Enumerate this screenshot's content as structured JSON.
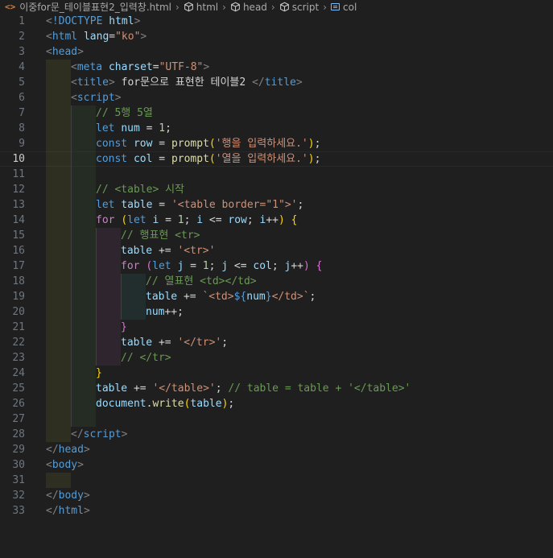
{
  "breadcrumb": {
    "file_name": "이중for문_테이블표현2_입력창.html",
    "items": [
      "html",
      "head",
      "script",
      "col"
    ]
  },
  "editor": {
    "current_line": 10,
    "lines": [
      {
        "n": 1,
        "indent": 0,
        "segs": [
          [
            "tag-punc",
            "<"
          ],
          [
            "tag",
            "!DOCTYPE"
          ],
          [
            "txt",
            " "
          ],
          [
            "attr",
            "html"
          ],
          [
            "tag-punc",
            ">"
          ]
        ]
      },
      {
        "n": 2,
        "indent": 0,
        "segs": [
          [
            "tag-punc",
            "<"
          ],
          [
            "tag",
            "html"
          ],
          [
            "txt",
            " "
          ],
          [
            "attr",
            "lang"
          ],
          [
            "txt",
            "="
          ],
          [
            "str",
            "\"ko\""
          ],
          [
            "tag-punc",
            ">"
          ]
        ]
      },
      {
        "n": 3,
        "indent": 0,
        "segs": [
          [
            "tag-punc",
            "<"
          ],
          [
            "tag",
            "head"
          ],
          [
            "tag-punc",
            ">"
          ]
        ]
      },
      {
        "n": 4,
        "indent": 1,
        "segs": [
          [
            "tag-punc",
            "<"
          ],
          [
            "tag",
            "meta"
          ],
          [
            "txt",
            " "
          ],
          [
            "attr",
            "charset"
          ],
          [
            "txt",
            "="
          ],
          [
            "str",
            "\"UTF-8\""
          ],
          [
            "tag-punc",
            ">"
          ]
        ]
      },
      {
        "n": 5,
        "indent": 1,
        "segs": [
          [
            "tag-punc",
            "<"
          ],
          [
            "tag",
            "title"
          ],
          [
            "tag-punc",
            ">"
          ],
          [
            "txt",
            " for문으로 표현한 테이블2 "
          ],
          [
            "tag-punc",
            "</"
          ],
          [
            "tag",
            "title"
          ],
          [
            "tag-punc",
            ">"
          ]
        ]
      },
      {
        "n": 6,
        "indent": 1,
        "segs": [
          [
            "tag-punc",
            "<"
          ],
          [
            "tag",
            "script"
          ],
          [
            "tag-punc",
            ">"
          ]
        ]
      },
      {
        "n": 7,
        "indent": 2,
        "segs": [
          [
            "cm",
            "// 5행 5열"
          ]
        ]
      },
      {
        "n": 8,
        "indent": 2,
        "segs": [
          [
            "kw",
            "let"
          ],
          [
            "op",
            " "
          ],
          [
            "var",
            "num"
          ],
          [
            "op",
            " = "
          ],
          [
            "num",
            "1"
          ],
          [
            "op",
            ";"
          ]
        ]
      },
      {
        "n": 9,
        "indent": 2,
        "segs": [
          [
            "kw",
            "const"
          ],
          [
            "op",
            " "
          ],
          [
            "var",
            "row"
          ],
          [
            "op",
            " = "
          ],
          [
            "fn",
            "prompt"
          ],
          [
            "br1",
            "("
          ],
          [
            "str",
            "'행을 입력하세요.'"
          ],
          [
            "br1",
            ")"
          ],
          [
            "op",
            ";"
          ]
        ]
      },
      {
        "n": 10,
        "indent": 2,
        "segs": [
          [
            "kw",
            "const"
          ],
          [
            "op",
            " "
          ],
          [
            "var",
            "col"
          ],
          [
            "op",
            " = "
          ],
          [
            "fn",
            "prompt"
          ],
          [
            "br1",
            "("
          ],
          [
            "str",
            "'열을 입력하세요.'"
          ],
          [
            "br1",
            ")"
          ],
          [
            "op",
            ";"
          ]
        ]
      },
      {
        "n": 11,
        "indent": 2,
        "segs": []
      },
      {
        "n": 12,
        "indent": 2,
        "segs": [
          [
            "cm",
            "// <table> 시작"
          ]
        ]
      },
      {
        "n": 13,
        "indent": 2,
        "segs": [
          [
            "kw",
            "let"
          ],
          [
            "op",
            " "
          ],
          [
            "var",
            "table"
          ],
          [
            "op",
            " = "
          ],
          [
            "str",
            "'<table border=\"1\">'"
          ],
          [
            "op",
            ";"
          ]
        ]
      },
      {
        "n": 14,
        "indent": 2,
        "segs": [
          [
            "ctrl",
            "for"
          ],
          [
            "op",
            " "
          ],
          [
            "br1",
            "("
          ],
          [
            "kw",
            "let"
          ],
          [
            "op",
            " "
          ],
          [
            "var",
            "i"
          ],
          [
            "op",
            " = "
          ],
          [
            "num",
            "1"
          ],
          [
            "op",
            "; "
          ],
          [
            "var",
            "i"
          ],
          [
            "op",
            " <= "
          ],
          [
            "var",
            "row"
          ],
          [
            "op",
            "; "
          ],
          [
            "var",
            "i"
          ],
          [
            "op",
            "++"
          ],
          [
            "br1",
            ")"
          ],
          [
            "op",
            " "
          ],
          [
            "br1",
            "{"
          ]
        ]
      },
      {
        "n": 15,
        "indent": 3,
        "segs": [
          [
            "cm",
            "// 행표현 <tr>"
          ]
        ]
      },
      {
        "n": 16,
        "indent": 3,
        "segs": [
          [
            "var",
            "table"
          ],
          [
            "op",
            " += "
          ],
          [
            "str",
            "'<tr>'"
          ]
        ]
      },
      {
        "n": 17,
        "indent": 3,
        "segs": [
          [
            "ctrl",
            "for"
          ],
          [
            "op",
            " "
          ],
          [
            "br2",
            "("
          ],
          [
            "kw",
            "let"
          ],
          [
            "op",
            " "
          ],
          [
            "var",
            "j"
          ],
          [
            "op",
            " = "
          ],
          [
            "num",
            "1"
          ],
          [
            "op",
            "; "
          ],
          [
            "var",
            "j"
          ],
          [
            "op",
            " <= "
          ],
          [
            "var",
            "col"
          ],
          [
            "op",
            "; "
          ],
          [
            "var",
            "j"
          ],
          [
            "op",
            "++"
          ],
          [
            "br2",
            ")"
          ],
          [
            "op",
            " "
          ],
          [
            "br2",
            "{"
          ]
        ]
      },
      {
        "n": 18,
        "indent": 4,
        "segs": [
          [
            "cm",
            "// 열표현 <td></td>"
          ]
        ]
      },
      {
        "n": 19,
        "indent": 4,
        "segs": [
          [
            "var",
            "table"
          ],
          [
            "op",
            " += "
          ],
          [
            "str",
            "`<td>"
          ],
          [
            "tplx",
            "${"
          ],
          [
            "var",
            "num"
          ],
          [
            "tplx",
            "}"
          ],
          [
            "str",
            "</td>`"
          ],
          [
            "op",
            ";"
          ]
        ]
      },
      {
        "n": 20,
        "indent": 4,
        "segs": [
          [
            "var",
            "num"
          ],
          [
            "op",
            "++;"
          ]
        ]
      },
      {
        "n": 21,
        "indent": 3,
        "segs": [
          [
            "br2",
            "}"
          ]
        ]
      },
      {
        "n": 22,
        "indent": 3,
        "segs": [
          [
            "var",
            "table"
          ],
          [
            "op",
            " += "
          ],
          [
            "str",
            "'</tr>'"
          ],
          [
            "op",
            ";"
          ]
        ]
      },
      {
        "n": 23,
        "indent": 3,
        "segs": [
          [
            "cm",
            "// </tr>"
          ]
        ]
      },
      {
        "n": 24,
        "indent": 2,
        "segs": [
          [
            "br1",
            "}"
          ]
        ]
      },
      {
        "n": 25,
        "indent": 2,
        "segs": [
          [
            "var",
            "table"
          ],
          [
            "op",
            " += "
          ],
          [
            "str",
            "'</table>'"
          ],
          [
            "op",
            "; "
          ],
          [
            "cm",
            "// table = table + '</table>'"
          ]
        ]
      },
      {
        "n": 26,
        "indent": 2,
        "segs": [
          [
            "var",
            "document"
          ],
          [
            "op",
            "."
          ],
          [
            "fn",
            "write"
          ],
          [
            "br1",
            "("
          ],
          [
            "var",
            "table"
          ],
          [
            "br1",
            ")"
          ],
          [
            "op",
            ";"
          ]
        ]
      },
      {
        "n": 27,
        "indent": 2,
        "segs": []
      },
      {
        "n": 28,
        "indent": 1,
        "segs": [
          [
            "tag-punc",
            "</"
          ],
          [
            "tag",
            "script"
          ],
          [
            "tag-punc",
            ">"
          ]
        ]
      },
      {
        "n": 29,
        "indent": 0,
        "segs": [
          [
            "tag-punc",
            "</"
          ],
          [
            "tag",
            "head"
          ],
          [
            "tag-punc",
            ">"
          ]
        ]
      },
      {
        "n": 30,
        "indent": 0,
        "segs": [
          [
            "tag-punc",
            "<"
          ],
          [
            "tag",
            "body"
          ],
          [
            "tag-punc",
            ">"
          ]
        ]
      },
      {
        "n": 31,
        "indent": 1,
        "segs": []
      },
      {
        "n": 32,
        "indent": 0,
        "segs": [
          [
            "tag-punc",
            "</"
          ],
          [
            "tag",
            "body"
          ],
          [
            "tag-punc",
            ">"
          ]
        ]
      },
      {
        "n": 33,
        "indent": 0,
        "segs": [
          [
            "tag-punc",
            "</"
          ],
          [
            "tag",
            "html"
          ],
          [
            "tag-punc",
            ">"
          ]
        ]
      }
    ]
  }
}
